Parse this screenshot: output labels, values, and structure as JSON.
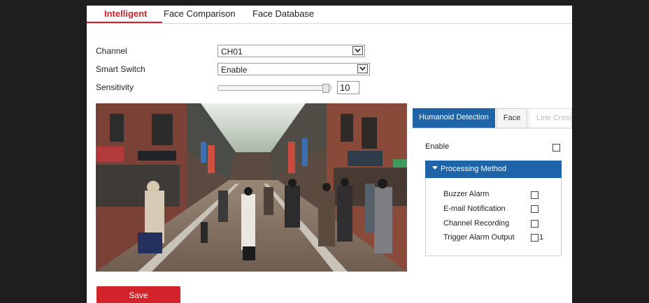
{
  "tabs": [
    {
      "label": "Intelligent",
      "active": true
    },
    {
      "label": "Face Comparison",
      "active": false
    },
    {
      "label": "Face Database",
      "active": false
    }
  ],
  "form": {
    "channel_label": "Channel",
    "channel_value": "CH01",
    "smart_switch_label": "Smart Switch",
    "smart_switch_value": "Enable",
    "sensitivity_label": "Sensitivity",
    "sensitivity_value": "10"
  },
  "detection_tabs": [
    {
      "label": "Humanoid Detection",
      "state": "active"
    },
    {
      "label": "Face",
      "state": "normal"
    },
    {
      "label": "Line Crossi",
      "state": "disabled"
    }
  ],
  "panel": {
    "enable_label": "Enable",
    "processing_method_label": "Processing Method",
    "options": [
      {
        "label": "Buzzer Alarm",
        "checked": false
      },
      {
        "label": "E-mail Notification",
        "checked": false
      },
      {
        "label": "Channel Recording",
        "checked": false
      },
      {
        "label": "Trigger Alarm Output",
        "checked": false,
        "suffix": "1"
      }
    ]
  },
  "save_label": "Save",
  "colors": {
    "accent_red": "#d2232a",
    "accent_blue": "#1f63a8",
    "frame_dark": "#1e1e1e"
  },
  "icons": {
    "select_arrow": "chevron-down-icon",
    "section_toggle": "caret-down-icon"
  }
}
